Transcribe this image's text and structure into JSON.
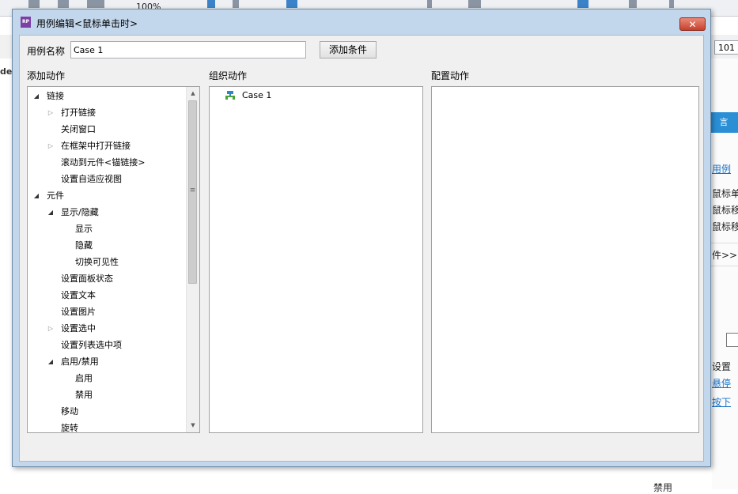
{
  "background": {
    "zoom": "100%",
    "field_value": "101",
    "dex_text": "dex",
    "tab_label": "言",
    "usecase_link": "用例",
    "events": [
      "鼠标单击",
      "鼠标移入",
      "鼠标移出"
    ],
    "more_conditions": "件>>>",
    "setting": "设置",
    "link_a": "悬停",
    "link_b": "按下",
    "bottom_label": "禁用",
    "colors": {
      "accent": "#2b8fd6"
    }
  },
  "dialog": {
    "title": "用例编辑<鼠标单击时>",
    "close_icon": "✕",
    "case_name_label": "用例名称",
    "case_name_value": "Case 1",
    "add_condition_label": "添加条件",
    "add_actions_header": "添加动作",
    "organize_actions_header": "组织动作",
    "configure_actions_header": "配置动作",
    "action_tree": [
      {
        "label": "链接",
        "toggle": "expanded"
      },
      {
        "label": "打开链接",
        "toggle": "collapsed"
      },
      {
        "label": "关闭窗口",
        "toggle": "none"
      },
      {
        "label": "在框架中打开链接",
        "toggle": "collapsed"
      },
      {
        "label": "滚动到元件<锚链接>",
        "toggle": "none"
      },
      {
        "label": "设置自适应视图",
        "toggle": "none"
      },
      {
        "label": "元件",
        "toggle": "expanded"
      },
      {
        "label": "显示/隐藏",
        "toggle": "expanded"
      },
      {
        "label": "显示",
        "toggle": "none"
      },
      {
        "label": "隐藏",
        "toggle": "none"
      },
      {
        "label": "切换可见性",
        "toggle": "none"
      },
      {
        "label": "设置面板状态",
        "toggle": "none"
      },
      {
        "label": "设置文本",
        "toggle": "none"
      },
      {
        "label": "设置图片",
        "toggle": "none"
      },
      {
        "label": "设置选中",
        "toggle": "collapsed"
      },
      {
        "label": "设置列表选中项",
        "toggle": "none"
      },
      {
        "label": "启用/禁用",
        "toggle": "expanded"
      },
      {
        "label": "启用",
        "toggle": "none"
      },
      {
        "label": "禁用",
        "toggle": "none"
      },
      {
        "label": "移动",
        "toggle": "none"
      },
      {
        "label": "旋转",
        "toggle": "none"
      }
    ],
    "organize_case": "Case 1",
    "colors": {
      "title_bg": "#c3d7ec",
      "close": "#c7402b",
      "app_icon": "#7b3fa6"
    }
  }
}
